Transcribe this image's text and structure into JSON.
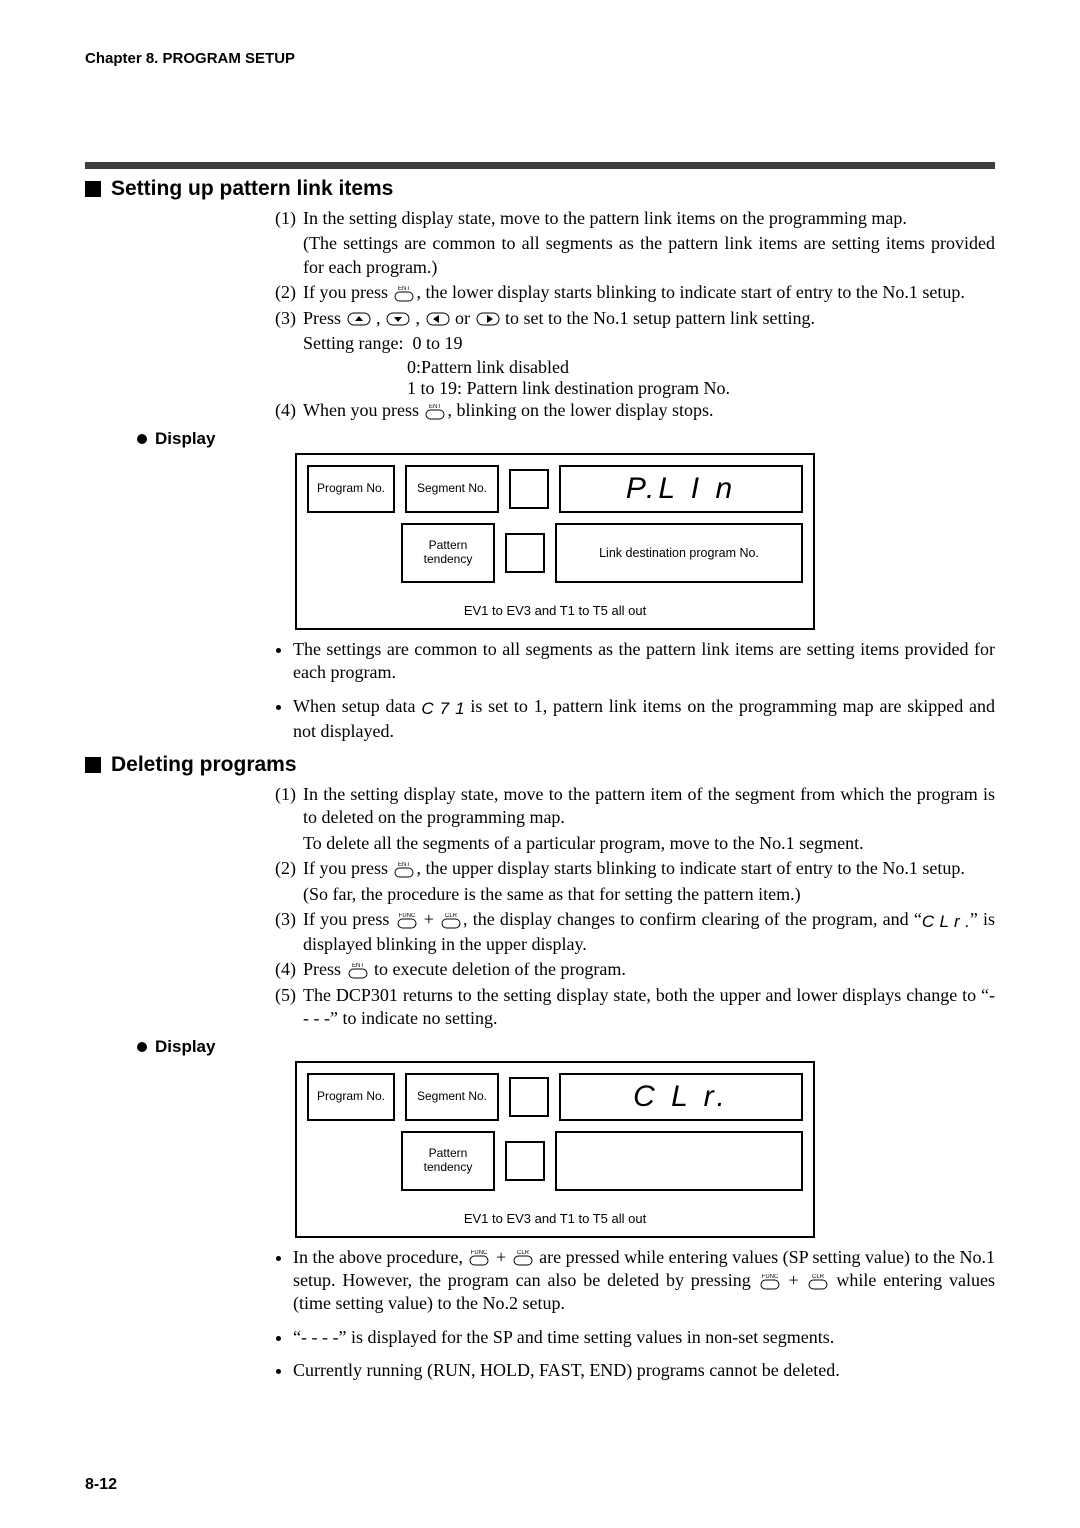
{
  "chapter_header": "Chapter 8. PROGRAM SETUP",
  "page_num": "8-12",
  "sec1": {
    "title": "Setting up pattern link items",
    "s1_num": "(1)",
    "s1_a": "In the setting display state, move to the pattern link items on the programming map.",
    "s1_b": "(The settings are common to all segments as the pattern link items are setting items provided for each program.)",
    "s2_num": "(2)",
    "s2_a_pre": "If you press ",
    "s2_a_post": ", the lower display starts blinking to indicate start of entry to the No.1 setup.",
    "s3_num": "(3)",
    "s3_pre": "Press ",
    "s3_mid": " , ",
    "s3_or": " or ",
    "s3_post": " to set to the No.1 setup pattern link setting.",
    "s3_range_lbl": "Setting range:",
    "s3_range_val": "0 to 19",
    "s3_r0": "0:Pattern link disabled",
    "s3_r1": "1 to 19:  Pattern link destination program No.",
    "s4_num": "(4)",
    "s4_pre": "When you press ",
    "s4_post": ", blinking on the lower display stops.",
    "display_label": "Display",
    "fig": {
      "progno": "Program No.",
      "segno": "Segment No.",
      "seg7": "P.L I n",
      "pattern1": "Pattern",
      "pattern2": "tendency",
      "linkdest": "Link destination program No.",
      "bottom": "EV1 to EV3 and T1 to T5 all out"
    },
    "b1": "The settings are common to all segments as the pattern link items are setting items provided for each program.",
    "b2_pre": "When setup data ",
    "b2_mid": " is set to 1, pattern link items on the programming map are skipped and not displayed.",
    "seg_c71": "C 7 1"
  },
  "sec2": {
    "title": "Deleting programs",
    "s1_num": "(1)",
    "s1_a": "In the setting display state, move to the pattern item of the segment from which the program is to deleted on the programming map.",
    "s1_b": "To delete all the segments of a particular program, move to the No.1 segment.",
    "s2_num": "(2)",
    "s2_pre": "If you press ",
    "s2_post": ", the upper display starts blinking to indicate start of entry to the No.1 setup.",
    "s2_b": "(So far, the procedure is the same as that for setting the pattern item.)",
    "s3_num": "(3)",
    "s3_pre": "If you press ",
    "s3_plus": " + ",
    "s3_post": ", the display changes to confirm clearing of the program, and “",
    "s3_seg": "C L r .",
    "s3_tail": "” is displayed blinking in the upper display.",
    "s4_num": "(4)",
    "s4_pre": "Press ",
    "s4_post": " to execute deletion of the program.",
    "s5_num": "(5)",
    "s5": "The DCP301 returns to the setting display state, both the upper and lower displays change to “- - - -” to indicate no setting.",
    "display_label": "Display",
    "fig": {
      "progno": "Program No.",
      "segno": "Segment No.",
      "seg7": "C L r.",
      "pattern1": "Pattern",
      "pattern2": "tendency",
      "bottom": "EV1 to EV3 and T1 to T5 all out"
    },
    "bl1_pre": "In the above procedure, ",
    "bl1_plus": " + ",
    "bl1_mid": " are pressed while entering values (SP setting value) to the No.1 setup. However, the program can also be deleted by pressing ",
    "bl1_plus2": " + ",
    "bl1_tail": " while entering values (time setting value) to the No.2 setup.",
    "bl2": "“- - - -” is displayed for the SP and time setting values in non-set segments.",
    "bl3": "Currently running (RUN, HOLD, FAST, END) programs cannot be deleted."
  },
  "keys": {
    "ent": "ENT",
    "func": "FUNC",
    "clr": "CLR"
  }
}
